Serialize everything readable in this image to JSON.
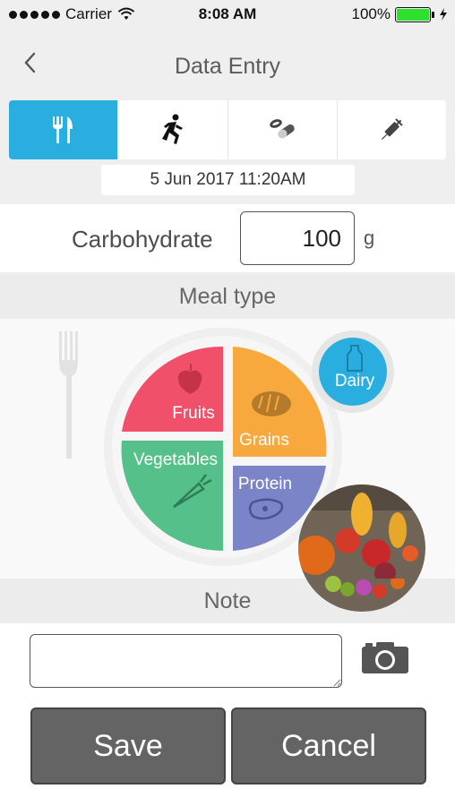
{
  "status_bar": {
    "carrier": "Carrier",
    "time": "8:08 AM",
    "battery": "100%"
  },
  "nav": {
    "title": "Data Entry"
  },
  "tabs": [
    {
      "icon": "fork-knife-icon",
      "active": true
    },
    {
      "icon": "running-icon",
      "active": false
    },
    {
      "icon": "pills-icon",
      "active": false
    },
    {
      "icon": "syringe-icon",
      "active": false
    }
  ],
  "entry": {
    "datetime": "5 Jun 2017 11:20AM"
  },
  "carb": {
    "label": "Carbohydrate",
    "value": "100",
    "unit": "g"
  },
  "meal": {
    "header": "Meal type",
    "segments": {
      "fruits": "Fruits",
      "grains": "Grains",
      "vegetables": "Vegetables",
      "protein": "Protein",
      "dairy": "Dairy"
    },
    "colors": {
      "fruits": "#f0506a",
      "grains": "#f7a93e",
      "vegetables": "#55c08a",
      "protein": "#7c84c8",
      "dairy": "#2aaee0"
    }
  },
  "note": {
    "header": "Note",
    "value": ""
  },
  "buttons": {
    "save": "Save",
    "cancel": "Cancel"
  },
  "accent_color": "#2aaee0"
}
